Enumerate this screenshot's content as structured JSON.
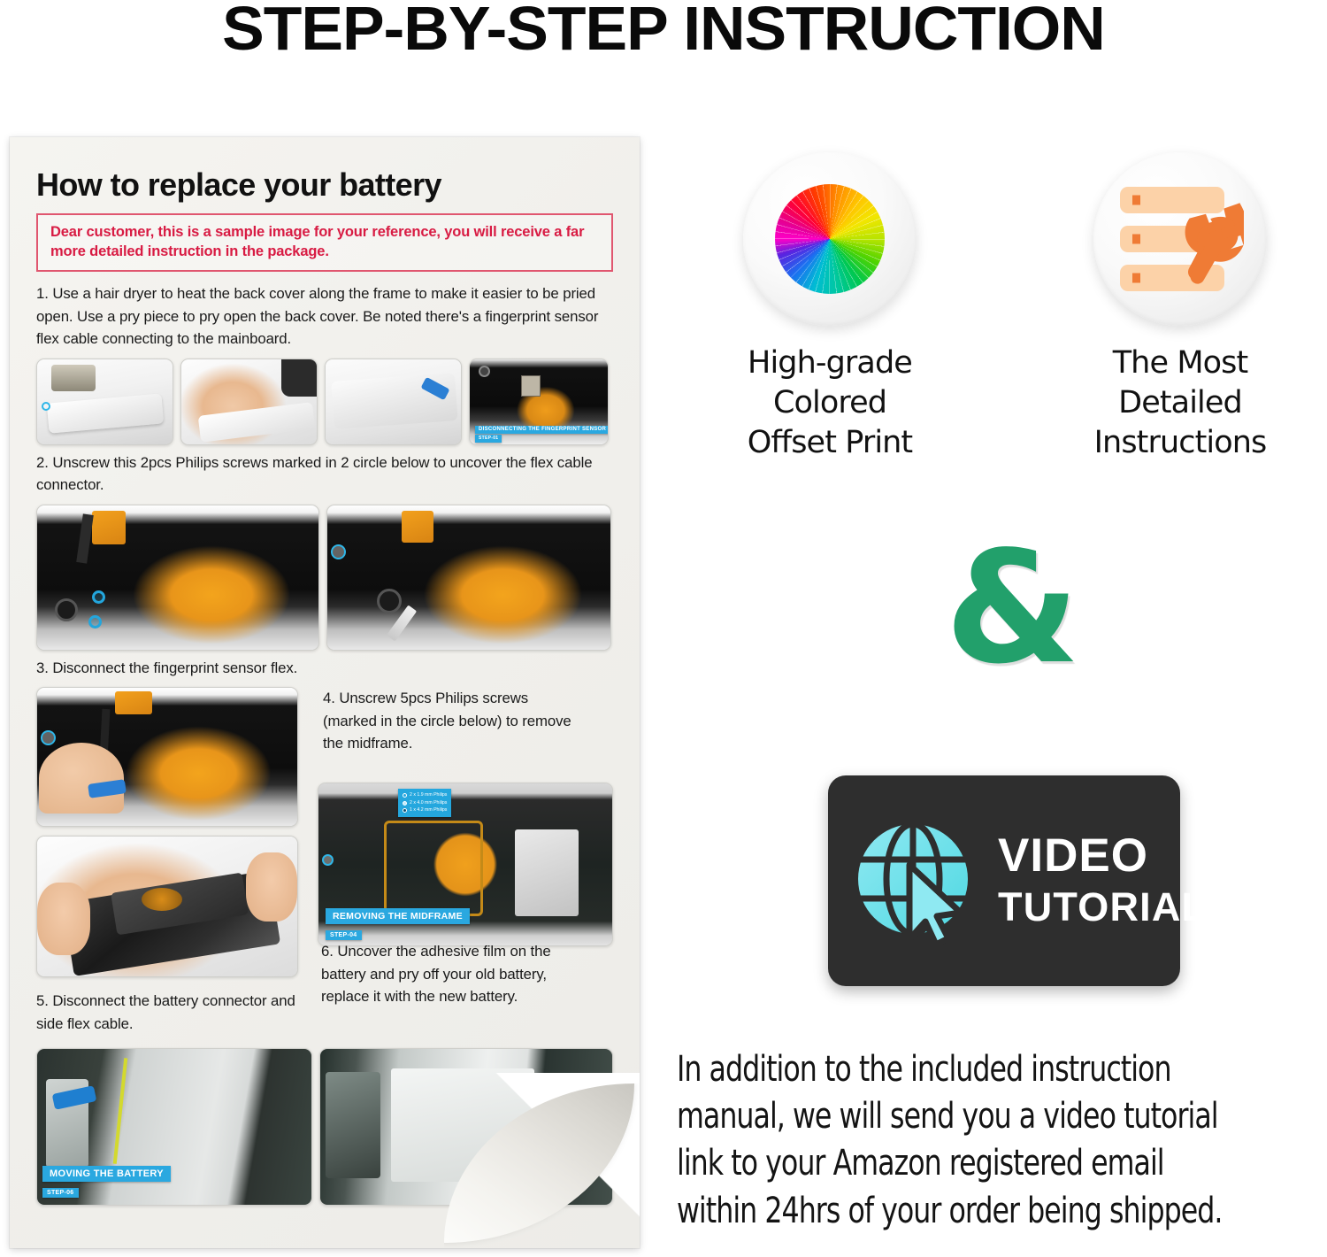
{
  "header": {
    "title": "STEP-BY-STEP INSTRUCTION"
  },
  "sheet": {
    "title": "How to replace your battery",
    "notice": "Dear customer, this is a sample image for your reference, you will receive a far more detailed instruction in the package.",
    "steps": [
      {
        "num": "1",
        "text": "1. Use a hair dryer to heat the back cover along the frame to make it easier to be pried open. Use a pry piece to pry open the back cover. Be noted there's a fingerprint sensor flex cable connecting to the mainboard."
      },
      {
        "num": "2",
        "text": "2. Unscrew this 2pcs Philips screws marked in 2 circle below to uncover the flex cable connector."
      },
      {
        "num": "3",
        "text": "3. Disconnect the fingerprint sensor flex."
      },
      {
        "num": "4",
        "text": "4. Unscrew 5pcs Philips screws (marked in the circle below) to remove the midframe."
      },
      {
        "num": "5",
        "text": "5. Disconnect the battery connector and side flex cable."
      },
      {
        "num": "6",
        "text": "6. Uncover the adhesive film on the battery and pry off your old battery, replace it with the new battery."
      }
    ],
    "photo_tags": {
      "fingerprint": "DISCONNECTING THE FINGERPRINT SENSOR",
      "fingerprint_step": "STEP-01",
      "midframe": "REMOVING THE MIDFRAME",
      "midframe_step": "STEP-04",
      "battery": "MOVING THE BATTERY",
      "battery_step": "STEP-06"
    },
    "screw_legend": [
      "2 x 1.9 mm Philips",
      "2 x 4.0 mm Philips",
      "1 x 4.2 mm Philips"
    ],
    "step_markers": [
      "1",
      "2",
      "3",
      "4",
      "5",
      "6"
    ]
  },
  "features": [
    {
      "icon": "color-wheel-icon",
      "label": "High-grade\nColored\nOffset Print",
      "line1": "High-grade",
      "line2": "Colored",
      "line3": "Offset Print"
    },
    {
      "icon": "wrench-manual-icon",
      "label": "The Most\nDetailed\nInstructions",
      "line1": "The Most",
      "line2": "Detailed",
      "line3": "Instructions"
    }
  ],
  "ampersand": "&",
  "video_card": {
    "line1": "VIDEO",
    "line2": "TUTORIAL",
    "icon": "globe-cursor-icon"
  },
  "bottom_note": {
    "line1": "In addition to the included instruction",
    "line2": "manual, we will send you a video tutorial",
    "line3": "link to your Amazon registered email",
    "line4": "within 24hrs of your order being shipped."
  },
  "colors": {
    "title": "#0a0a0a",
    "notice_red": "#d81b43",
    "notice_border": "#e0566f",
    "tag_blue": "#2aa8e0",
    "ampersand_green": "#22a06b",
    "video_card_bg": "#2e2e2e",
    "globe_cyan": "#7fe3ef",
    "wrench_orange": "#ef7b35",
    "bar_peach": "#fcd2a8",
    "sheet_paper": "#f1f0ec"
  }
}
